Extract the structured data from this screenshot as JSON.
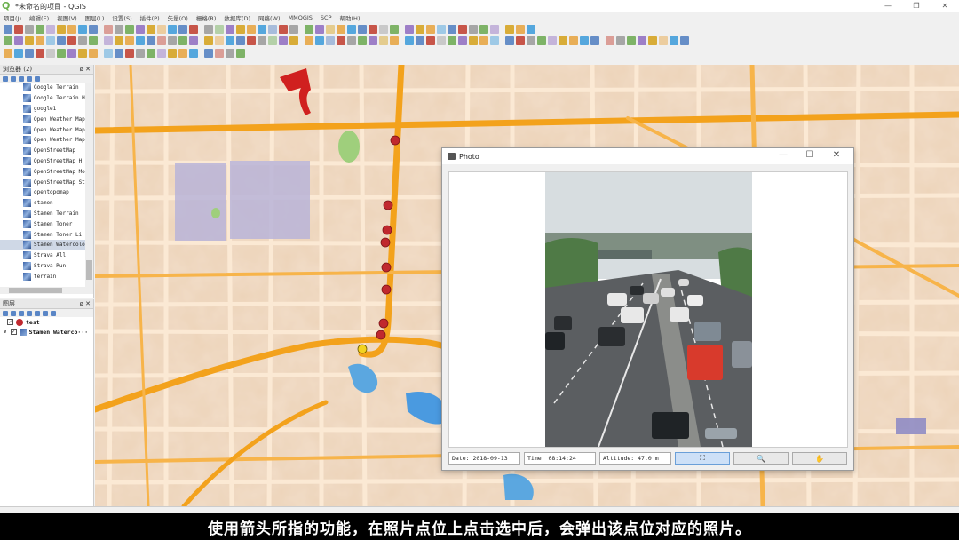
{
  "window": {
    "title": "*未命名的项目 - QGIS",
    "controls": [
      "—",
      "❐",
      "✕"
    ]
  },
  "menu": [
    "项目(J)",
    "编辑(E)",
    "视图(V)",
    "图层(L)",
    "设置(S)",
    "插件(P)",
    "矢量(O)",
    "栅格(R)",
    "数据库(D)",
    "网络(W)",
    "MMQGIS",
    "SCP",
    "帮助(H)"
  ],
  "browser_panel": {
    "title": "浏览器 (2)",
    "controls": "ø ✕",
    "items": [
      "Google Terrain",
      "Google Terrain H",
      "google1",
      "Open Weather Map",
      "Open Weather Map",
      "Open Weather Map",
      "OpenStreetMap",
      "OpenStreetMap H",
      "OpenStreetMap Mo",
      "OpenStreetMap St",
      "opentopomap",
      "stamen",
      "Stamen Terrain",
      "Stamen Toner",
      "Stamen Toner Li",
      "Stamen Watercolo",
      "Strava All",
      "Strava Run",
      "terrain"
    ],
    "selected_index": 15
  },
  "layers_panel": {
    "title": "图层",
    "controls": "ø ✕",
    "layers": [
      {
        "name": "test",
        "checked": true,
        "kind": "points"
      },
      {
        "name": "Stamen Waterco···",
        "checked": true,
        "kind": "raster"
      }
    ]
  },
  "photo_window": {
    "title": "Photo",
    "date": "Date: 2018-09-13",
    "time": "Time: 08:14:24",
    "altitude": "Altitude: 47.0 m",
    "buttons": [
      "⛶",
      "🔍",
      "✋"
    ]
  },
  "subtitle": "使用箭头所指的功能，在照片点位上点击选中后，会弹出该点位对应的照片。",
  "colors": {
    "map_base": "#ecd3b8",
    "road_major": "#f3a21c",
    "road_minor": "#fbe6cc",
    "point_red": "#c0282e",
    "point_selected": "#f3d320",
    "arrow_red": "#d0201f"
  }
}
